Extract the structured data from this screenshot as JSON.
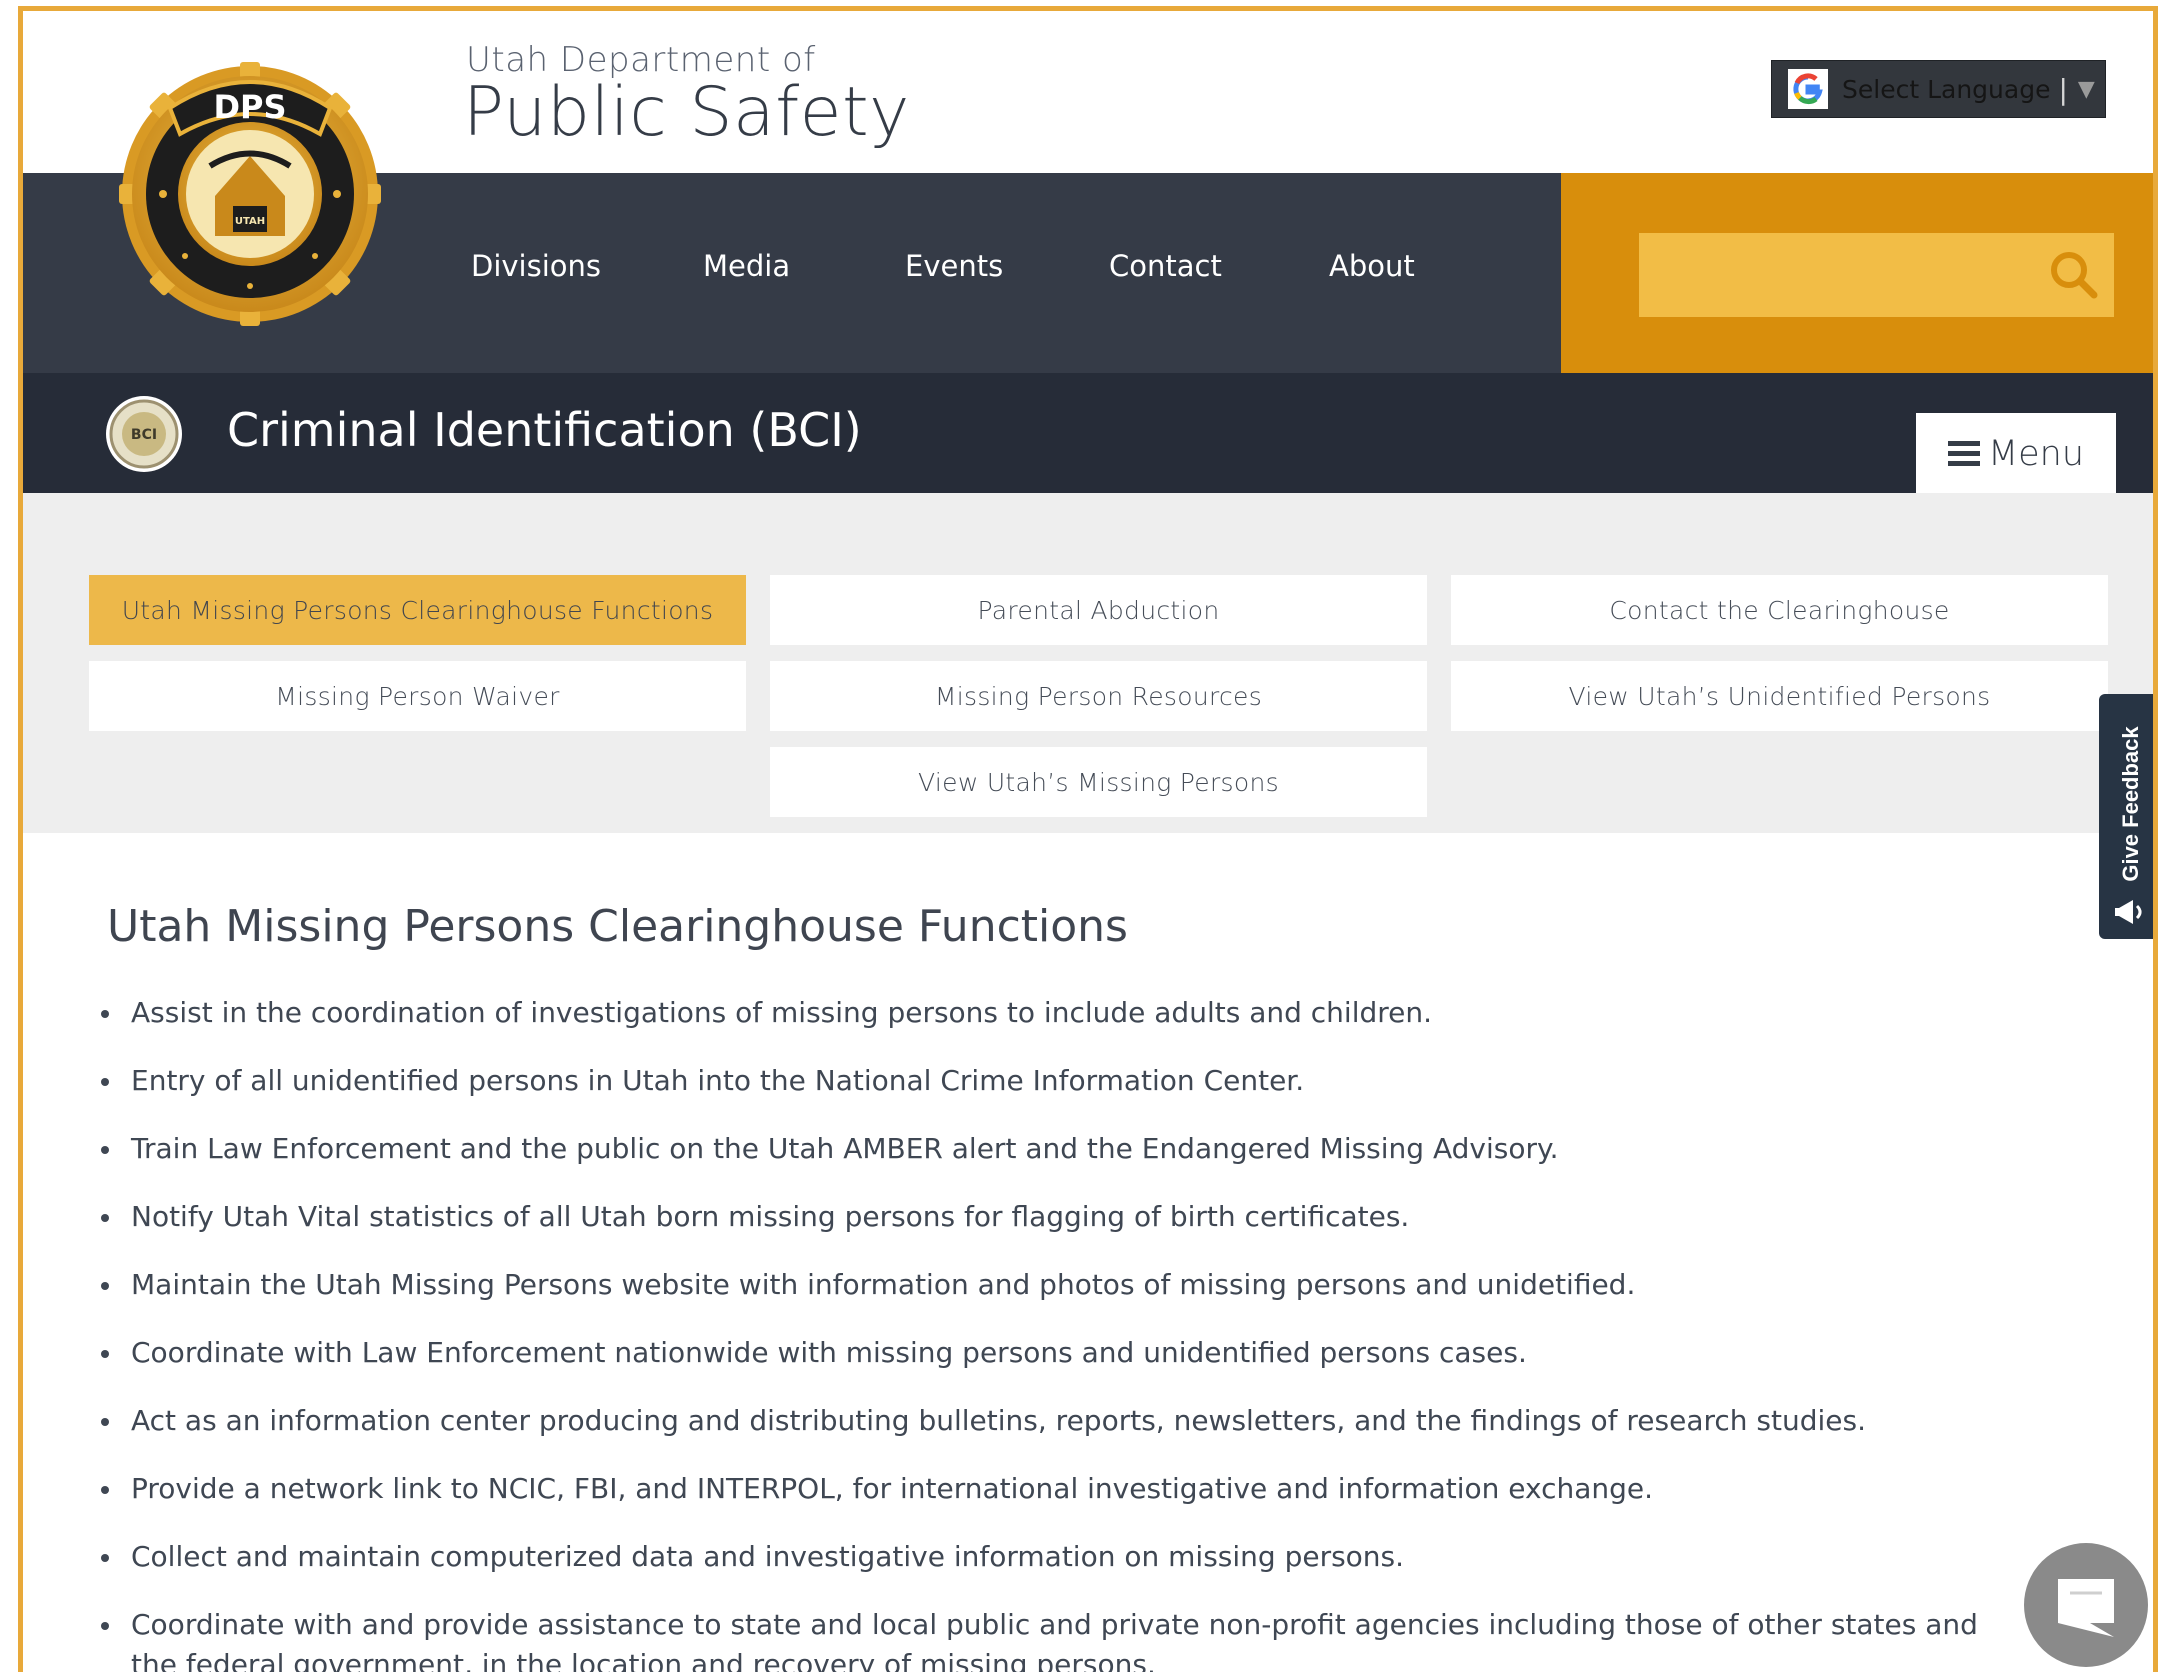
{
  "header": {
    "department_line": "Utah Department of",
    "agency_name": "Public Safety",
    "logo_icon": "dps-utah-badge-icon",
    "language_select": {
      "label": "Select Language",
      "separator": "|",
      "arrow": "▼"
    }
  },
  "nav": {
    "items": [
      {
        "label": "Divisions"
      },
      {
        "label": "Media"
      },
      {
        "label": "Events"
      },
      {
        "label": "Contact"
      },
      {
        "label": "About"
      }
    ],
    "search": {
      "placeholder": "",
      "icon": "search-icon"
    }
  },
  "division": {
    "title": "Criminal Identification (BCI)",
    "seal_icon": "bci-seal-icon",
    "menu_label": "Menu"
  },
  "subnav": {
    "items": [
      {
        "label": "Utah Missing Persons Clearinghouse Functions",
        "active": true
      },
      {
        "label": "Parental Abduction"
      },
      {
        "label": "Contact the Clearinghouse"
      },
      {
        "label": "Missing Person Waiver"
      },
      {
        "label": "Missing Person Resources"
      },
      {
        "label": "View Utah’s Unidentified Persons"
      },
      {
        "label": "View Utah’s Missing Persons"
      }
    ]
  },
  "feedback": {
    "label": "Give Feedback"
  },
  "content": {
    "heading": "Utah Missing Persons Clearinghouse Functions",
    "bullets": [
      "Assist in the coordination of investigations of missing persons to include adults and children.",
      "Entry of all unidentified persons in Utah into the National Crime Information Center.",
      "Train Law Enforcement and the public on the Utah AMBER alert and the Endangered Missing Advisory.",
      "Notify Utah Vital statistics of all Utah born missing persons for flagging of birth certificates.",
      "Maintain the Utah Missing Persons website with information and photos of missing persons and unidetified.",
      "Coordinate with Law Enforcement nationwide with missing persons and unidentified persons cases.",
      "Act as an information center producing and distributing bulletins, reports, newsletters, and the findings of research studies.",
      "Provide a network link to NCIC, FBI, and INTERPOL, for international investigative and information exchange.",
      "Collect and maintain computerized data and investigative information on missing persons.",
      "Coordinate with and provide assistance to state and local public and private non-profit agencies including those of other states and the federal government, in the location and recovery of missing persons."
    ]
  },
  "colors": {
    "accent_gold": "#d88e0c",
    "highlight_gold": "#edb84a",
    "nav_dark": "#353b47",
    "band_dark": "#262c38",
    "frame_border": "#e8a93a"
  }
}
